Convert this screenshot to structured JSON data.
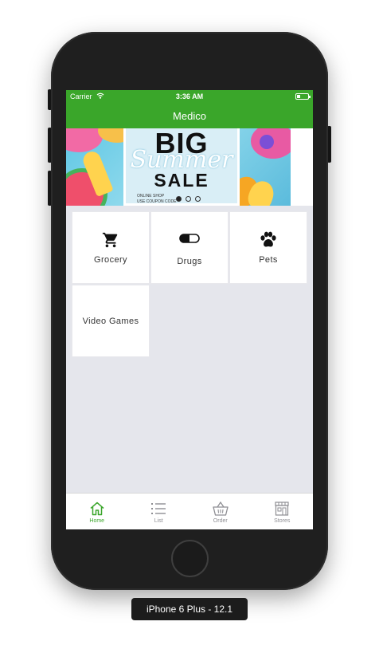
{
  "status_bar": {
    "carrier": "Carrier",
    "time": "3:36 AM"
  },
  "nav": {
    "title": "Medico"
  },
  "banner": {
    "big": "BIG",
    "summer": "Summer",
    "sale": "SALE",
    "online": "ONLINE SHOP",
    "coupon": "USE COUPON CODE",
    "page_count": 3,
    "active_page": 0
  },
  "categories": [
    {
      "label": "Grocery",
      "icon": "cart-icon"
    },
    {
      "label": "Drugs",
      "icon": "pill-icon"
    },
    {
      "label": "Pets",
      "icon": "paw-icon"
    },
    {
      "label": "Video Games",
      "icon": ""
    }
  ],
  "tabs": [
    {
      "label": "Home",
      "icon": "home-icon",
      "active": true
    },
    {
      "label": "List",
      "icon": "list-icon",
      "active": false
    },
    {
      "label": "Order",
      "icon": "basket-icon",
      "active": false
    },
    {
      "label": "Stores",
      "icon": "store-icon",
      "active": false
    }
  ],
  "device_label": "iPhone 6 Plus - 12.1",
  "colors": {
    "accent": "#3aa62a",
    "background": "#e5e6ec",
    "tab_inactive": "#8e8e93"
  }
}
